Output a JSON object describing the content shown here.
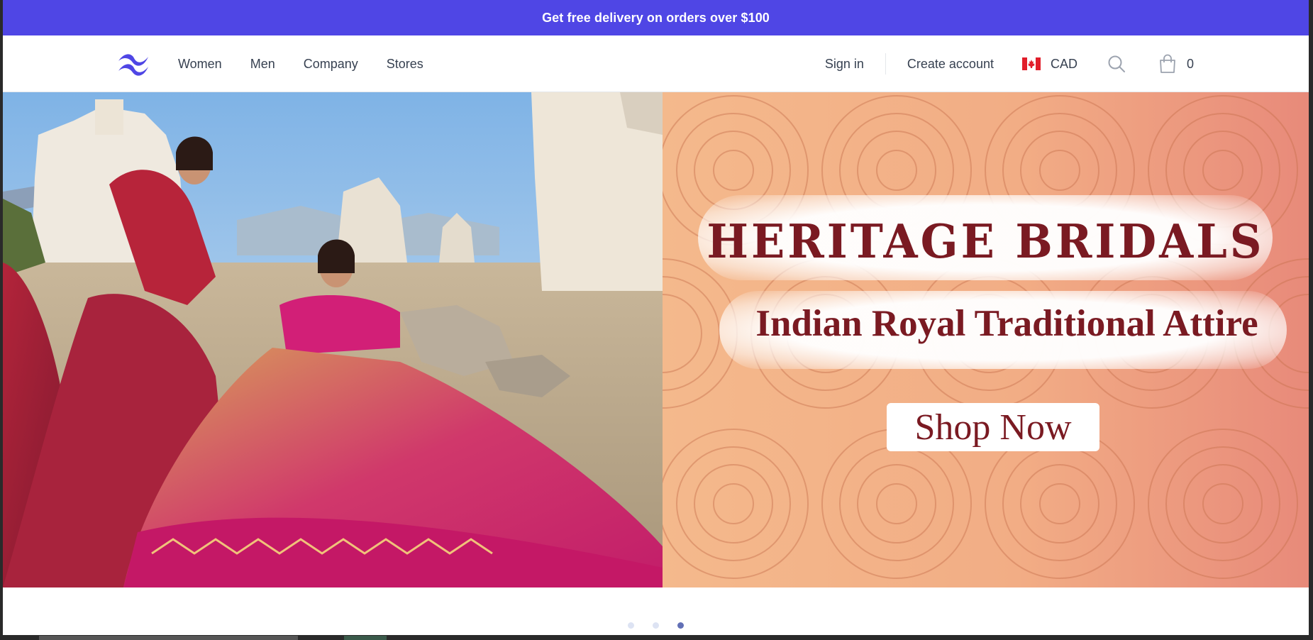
{
  "promo": {
    "text": "Get free delivery on orders over $100"
  },
  "nav": {
    "menu": [
      "Women",
      "Men",
      "Company",
      "Stores"
    ],
    "sign_in": "Sign in",
    "create_account": "Create account",
    "currency": "CAD",
    "cart_count": "0"
  },
  "hero": {
    "title": "HERITAGE BRIDALS",
    "subtitle": "Indian Royal Traditional Attire",
    "cta": "Shop Now"
  },
  "carousel": {
    "active_index": 2,
    "total": 3
  },
  "colors": {
    "accent": "#4f46e5",
    "banner_text": "#7a1a22"
  }
}
